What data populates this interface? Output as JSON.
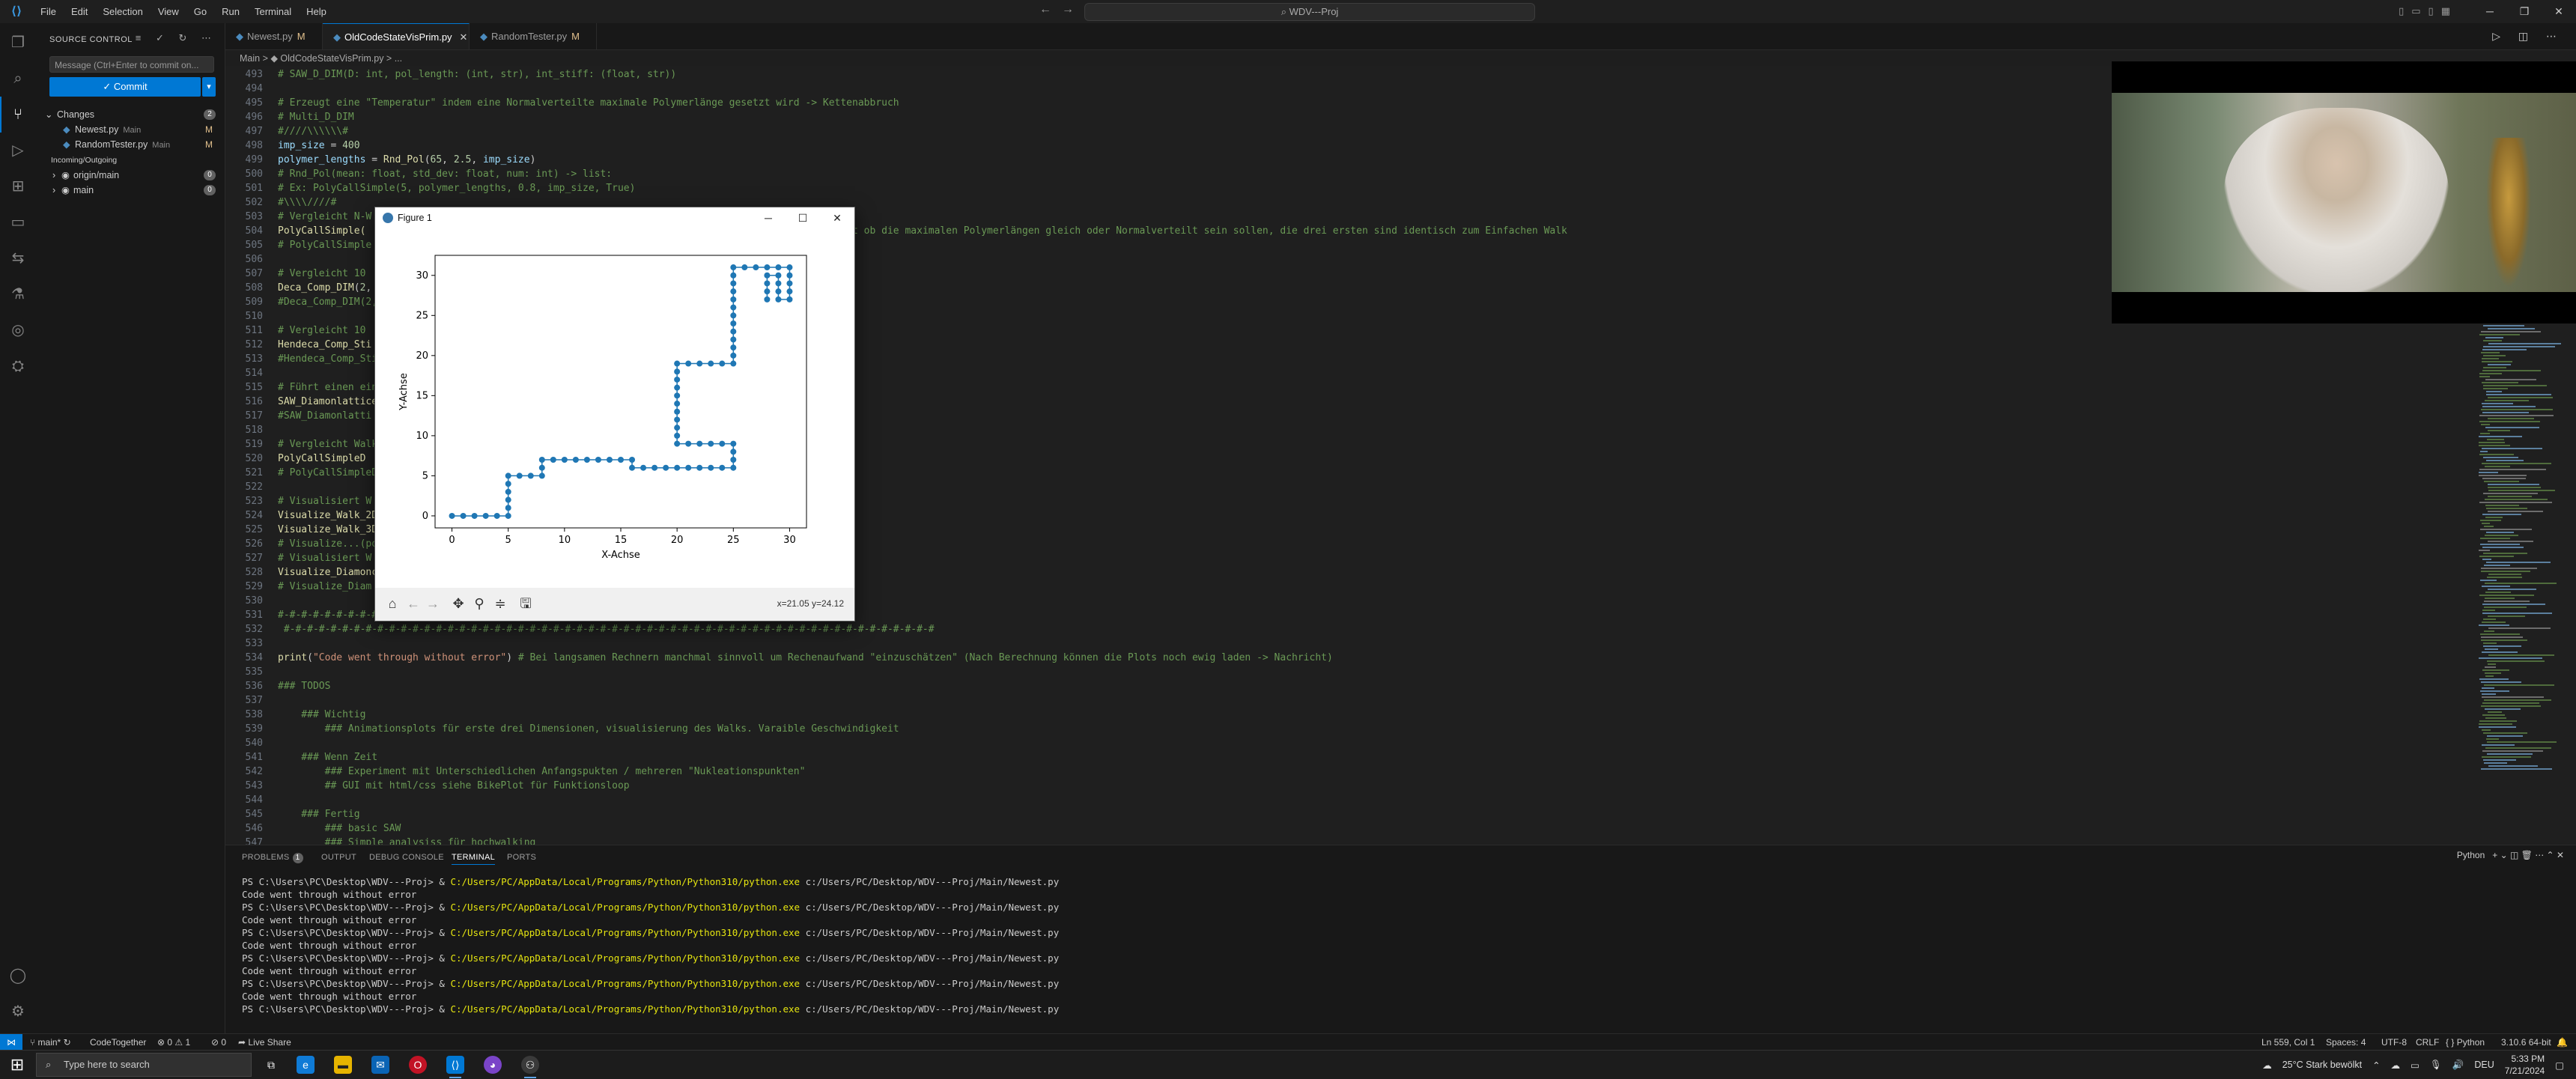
{
  "titlebar": {
    "menu": [
      "File",
      "Edit",
      "Selection",
      "View",
      "Go",
      "Run",
      "Terminal",
      "Help"
    ],
    "search": "WDV---Proj"
  },
  "sidebar": {
    "title": "SOURCE CONTROL",
    "message_placeholder": "Message (Ctrl+Enter to commit on...",
    "commit_label": "✓ Commit",
    "changes_label": "Changes",
    "changes_count": "2",
    "files": [
      {
        "name": "Newest.py",
        "folder": "Main",
        "status": "M"
      },
      {
        "name": "RandomTester.py",
        "folder": "Main",
        "status": "M"
      }
    ],
    "incoming_label": "Incoming/Outgoing",
    "branches": [
      {
        "name": "origin/main",
        "count": "0"
      },
      {
        "name": "main",
        "count": "0"
      }
    ]
  },
  "tabs": [
    {
      "name": "Newest.py",
      "flag": "M",
      "active": false
    },
    {
      "name": "OldCodeStateVisPrim.py",
      "flag": "",
      "active": true
    },
    {
      "name": "RandomTester.py",
      "flag": "M",
      "active": false
    }
  ],
  "breadcrumb": "Main  >  ◆ OldCodeStateVisPrim.py  >  ...",
  "code": [
    {
      "n": "493",
      "parts": [
        [
          "c-comment",
          "# SAW_D_DIM(D: int, pol_length: (int, str), int_stiff: (float, str))"
        ]
      ]
    },
    {
      "n": "494",
      "parts": []
    },
    {
      "n": "495",
      "parts": [
        [
          "c-comment",
          "# Erzeugt eine \"Temperatur\" indem eine Normalverteilte maximale Polymerlänge gesetzt wird -> Kettenabbruch"
        ]
      ]
    },
    {
      "n": "496",
      "parts": [
        [
          "c-comment",
          "# Multi_D_DIM"
        ]
      ]
    },
    {
      "n": "497",
      "parts": [
        [
          "c-comment",
          "#////\\\\\\\\\\\\#"
        ]
      ]
    },
    {
      "n": "498",
      "parts": [
        [
          "c-var",
          "imp_size"
        ],
        [
          "c-plain",
          " = "
        ],
        [
          "c-num",
          "400"
        ]
      ]
    },
    {
      "n": "499",
      "parts": [
        [
          "c-var",
          "polymer_lengths"
        ],
        [
          "c-plain",
          " = "
        ],
        [
          "c-fn",
          "Rnd_Pol"
        ],
        [
          "c-plain",
          "("
        ],
        [
          "c-num",
          "65"
        ],
        [
          "c-plain",
          ", "
        ],
        [
          "c-num",
          "2.5"
        ],
        [
          "c-plain",
          ", "
        ],
        [
          "c-var",
          "imp_size"
        ],
        [
          "c-plain",
          ")"
        ]
      ]
    },
    {
      "n": "500",
      "parts": [
        [
          "c-comment",
          "# Rnd_Pol(mean: float, std_dev: float, num: int) -> list:"
        ]
      ]
    },
    {
      "n": "501",
      "parts": [
        [
          "c-comment",
          "# Ex: PolyCallSimple(5, polymer_lengths, 0.8, imp_size, True)"
        ]
      ]
    },
    {
      "n": "502",
      "parts": [
        [
          "c-comment",
          "#\\\\\\\\////#"
        ]
      ]
    },
    {
      "n": "503",
      "parts": [
        [
          "c-comment",
          "# Vergleicht N-W"
        ]
      ]
    },
    {
      "n": "504",
      "parts": [
        [
          "c-fn",
          "PolyCallSimple("
        ],
        [
          "c-plain",
          "                                                        "
        ],
        [
          "c-comment",
          "dtype: int, Argument 5 fragt ob die maximalen Polymerlängen gleich oder Normalverteilt sein sollen, die drei ersten sind identisch zum Einfachen Walk"
        ]
      ]
    },
    {
      "n": "505",
      "parts": [
        [
          "c-comment",
          "# PolyCallSimple"
        ]
      ]
    },
    {
      "n": "506",
      "parts": []
    },
    {
      "n": "507",
      "parts": [
        [
          "c-comment",
          "# Vergleicht 10"
        ]
      ]
    },
    {
      "n": "508",
      "parts": [
        [
          "c-fn",
          "Deca_Comp_DIM"
        ],
        [
          "c-plain",
          "("
        ],
        [
          "c-num",
          "2"
        ],
        [
          "c-plain",
          ","
        ]
      ]
    },
    {
      "n": "509",
      "parts": [
        [
          "c-comment",
          "#Deca_Comp_DIM(2,"
        ]
      ]
    },
    {
      "n": "510",
      "parts": []
    },
    {
      "n": "511",
      "parts": [
        [
          "c-comment",
          "# Vergleicht 10"
        ]
      ]
    },
    {
      "n": "512",
      "parts": [
        [
          "c-fn",
          "Hendeca_Comp_Sti"
        ]
      ]
    },
    {
      "n": "513",
      "parts": [
        [
          "c-comment",
          "#Hendeca_Comp_Sti"
        ]
      ]
    },
    {
      "n": "514",
      "parts": []
    },
    {
      "n": "515",
      "parts": [
        [
          "c-comment",
          "# Führt einen ein"
        ]
      ]
    },
    {
      "n": "516",
      "parts": [
        [
          "c-fn",
          "SAW_Diamonlattice"
        ]
      ]
    },
    {
      "n": "517",
      "parts": [
        [
          "c-comment",
          "#SAW_Diamonlatti"
        ]
      ]
    },
    {
      "n": "518",
      "parts": []
    },
    {
      "n": "519",
      "parts": [
        [
          "c-comment",
          "# Vergleicht Walk"
        ]
      ]
    },
    {
      "n": "520",
      "parts": [
        [
          "c-fn",
          "PolyCallSimpleD"
        ]
      ]
    },
    {
      "n": "521",
      "parts": [
        [
          "c-comment",
          "# PolyCallSimpleD"
        ]
      ]
    },
    {
      "n": "522",
      "parts": []
    },
    {
      "n": "523",
      "parts": [
        [
          "c-comment",
          "# Visualisiert W"
        ]
      ]
    },
    {
      "n": "524",
      "parts": [
        [
          "c-fn",
          "Visualize_Walk_2D"
        ]
      ]
    },
    {
      "n": "525",
      "parts": [
        [
          "c-fn",
          "Visualize_Walk_3D"
        ]
      ]
    },
    {
      "n": "526",
      "parts": [
        [
          "c-comment",
          "# Visualize...(po"
        ]
      ]
    },
    {
      "n": "527",
      "parts": [
        [
          "c-comment",
          "# Visualisiert W"
        ]
      ]
    },
    {
      "n": "528",
      "parts": [
        [
          "c-fn",
          "Visualize_Diamonc"
        ]
      ]
    },
    {
      "n": "529",
      "parts": [
        [
          "c-comment",
          "# Visualize_Diam"
        ]
      ]
    },
    {
      "n": "530",
      "parts": []
    },
    {
      "n": "531",
      "parts": [
        [
          "c-comment",
          "#-#-#-#-#-#-#-#-#"
        ]
      ]
    },
    {
      "n": "532",
      "parts": [
        [
          "c-comment",
          " #-#-#-#-#-#-#-#-#-#-#-#-#-#-#-#-#-#-#-#-#-#-#-#-#-#-#-#-#-#-#-#-#-#-#-#-#-#-#-#-#-#-#-#-#-#-#-#-#-#-#-#-#-#-#-#"
        ]
      ]
    },
    {
      "n": "533",
      "parts": []
    },
    {
      "n": "534",
      "parts": [
        [
          "c-fn",
          "print"
        ],
        [
          "c-plain",
          "("
        ],
        [
          "c-str",
          "\"Code went through without error\""
        ],
        [
          "c-plain",
          ") "
        ],
        [
          "c-comment",
          "# Bei langsamen Rechnern manchmal sinnvoll um Rechenaufwand \"einzuschätzen\" (Nach Berechnung können die Plots noch ewig laden -> Nachricht)"
        ]
      ]
    },
    {
      "n": "535",
      "parts": []
    },
    {
      "n": "536",
      "parts": [
        [
          "c-comment",
          "### TODOS"
        ]
      ]
    },
    {
      "n": "537",
      "parts": []
    },
    {
      "n": "538",
      "parts": [
        [
          "c-comment",
          "    ### Wichtig"
        ]
      ]
    },
    {
      "n": "539",
      "parts": [
        [
          "c-comment",
          "        ### Animationsplots für erste drei Dimensionen, visualisierung des Walks. Varaible Geschwindigkeit"
        ]
      ]
    },
    {
      "n": "540",
      "parts": []
    },
    {
      "n": "541",
      "parts": [
        [
          "c-comment",
          "    ### Wenn Zeit"
        ]
      ]
    },
    {
      "n": "542",
      "parts": [
        [
          "c-comment",
          "        ### Experiment mit Unterschiedlichen Anfangspukten / mehreren \"Nukleationspunkten\""
        ]
      ]
    },
    {
      "n": "543",
      "parts": [
        [
          "c-comment",
          "        ## GUI mit html/css siehe BikePlot für Funktionsloop"
        ]
      ]
    },
    {
      "n": "544",
      "parts": []
    },
    {
      "n": "545",
      "parts": [
        [
          "c-comment",
          "    ### Fertig"
        ]
      ]
    },
    {
      "n": "546",
      "parts": [
        [
          "c-comment",
          "        ### basic SAW"
        ]
      ]
    },
    {
      "n": "547",
      "parts": [
        [
          "c-comment",
          "        ### Simple analysiss für hochwalking"
        ]
      ]
    }
  ],
  "panel": {
    "tabs": [
      "PROBLEMS",
      "OUTPUT",
      "DEBUG CONSOLE",
      "TERMINAL",
      "PORTS"
    ],
    "problems_count": "1",
    "active_tab": "TERMINAL",
    "shell": "Python",
    "terminal": [
      {
        "prompt": "PS C:\\Users\\PC\\Desktop\\WDV---Proj> & ",
        "exe": "C:/Users/PC/AppData/Local/Programs/Python/Python310/python.exe",
        "arg": " c:/Users/PC/Desktop/WDV---Proj/Main/Newest.py"
      },
      {
        "text": "Code went through without error"
      },
      {
        "prompt": "PS C:\\Users\\PC\\Desktop\\WDV---Proj> & ",
        "exe": "C:/Users/PC/AppData/Local/Programs/Python/Python310/python.exe",
        "arg": " c:/Users/PC/Desktop/WDV---Proj/Main/Newest.py"
      },
      {
        "text": "Code went through without error"
      },
      {
        "prompt": "PS C:\\Users\\PC\\Desktop\\WDV---Proj> & ",
        "exe": "C:/Users/PC/AppData/Local/Programs/Python/Python310/python.exe",
        "arg": " c:/Users/PC/Desktop/WDV---Proj/Main/Newest.py"
      },
      {
        "text": "Code went through without error"
      },
      {
        "prompt": "PS C:\\Users\\PC\\Desktop\\WDV---Proj> & ",
        "exe": "C:/Users/PC/AppData/Local/Programs/Python/Python310/python.exe",
        "arg": " c:/Users/PC/Desktop/WDV---Proj/Main/Newest.py"
      },
      {
        "text": "Code went through without error"
      },
      {
        "prompt": "PS C:\\Users\\PC\\Desktop\\WDV---Proj> & ",
        "exe": "C:/Users/PC/AppData/Local/Programs/Python/Python310/python.exe",
        "arg": " c:/Users/PC/Desktop/WDV---Proj/Main/Newest.py"
      },
      {
        "text": "Code went through without error"
      },
      {
        "prompt": "PS C:\\Users\\PC\\Desktop\\WDV---Proj> & ",
        "exe": "C:/Users/PC/AppData/Local/Programs/Python/Python310/python.exe",
        "arg": " c:/Users/PC/Desktop/WDV---Proj/Main/Newest.py"
      }
    ]
  },
  "statusbar": {
    "branch": "main*",
    "codetogether": "CodeTogether",
    "problems": "⊗ 0 ⚠ 1",
    "ports": "⊘ 0",
    "liveshare": "Live Share",
    "position": "Ln 559, Col 1",
    "spaces": "Spaces: 4",
    "encoding": "UTF-8",
    "eol": "CRLF",
    "language": "Python",
    "interpreter": "3.10.6 64-bit"
  },
  "figure": {
    "title": "Figure 1",
    "coords": "x=21.05 y=24.12",
    "tools": [
      "home-icon",
      "back-icon",
      "forward-icon",
      "pan-icon",
      "zoom-icon",
      "configure-icon",
      "save-icon"
    ]
  },
  "chart_data": {
    "type": "line",
    "marker": "o",
    "color": "#1f77b4",
    "xlabel": "X-Achse",
    "ylabel": "Y-Achse",
    "xlim": [
      -1.5,
      31.5
    ],
    "ylim": [
      -1.5,
      32.5
    ],
    "xticks": [
      0,
      5,
      10,
      15,
      20,
      25,
      30
    ],
    "yticks": [
      0,
      5,
      10,
      15,
      20,
      25,
      30
    ],
    "vertices": [
      [
        0,
        0
      ],
      [
        5,
        0
      ],
      [
        5,
        5
      ],
      [
        8,
        5
      ],
      [
        8,
        7
      ],
      [
        16,
        7
      ],
      [
        16,
        6
      ],
      [
        25,
        6
      ],
      [
        25,
        9
      ],
      [
        20,
        9
      ],
      [
        20,
        19
      ],
      [
        25,
        19
      ],
      [
        25,
        31
      ],
      [
        30,
        31
      ],
      [
        30,
        27
      ],
      [
        29,
        27
      ],
      [
        29,
        30
      ],
      [
        28,
        30
      ],
      [
        28,
        27
      ]
    ]
  },
  "taskbar": {
    "search_placeholder": "Type here to search",
    "weather": "25°C  Stark bewölkt",
    "lang": "DEU",
    "time": "5:33 PM",
    "date": "7/21/2024"
  }
}
